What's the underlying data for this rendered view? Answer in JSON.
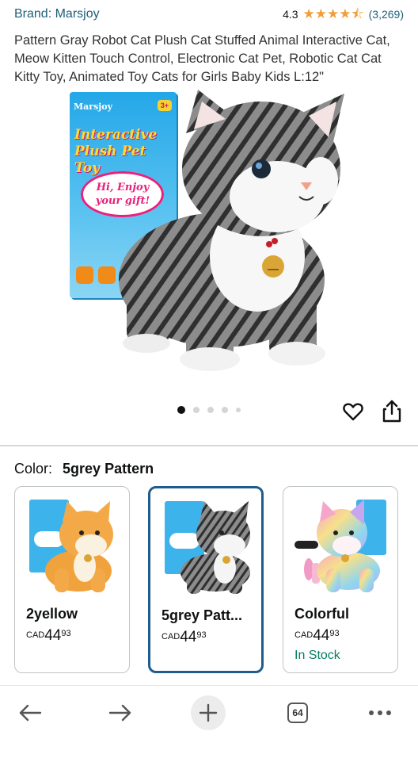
{
  "header": {
    "brand": "Brand: Marsjoy",
    "rating_value": "4.3",
    "rating_stars": 4.3,
    "rating_count": "(3,269)"
  },
  "product": {
    "title": "Pattern Gray Robot Cat Plush Cat Stuffed Animal Interactive Cat, Meow Kitten Touch Control, Electronic Cat Pet, Robotic Cat Cat Kitty Toy, Animated Toy Cats for Girls Baby Kids L:12\"",
    "box_logo": "Marsjoy",
    "box_age": "3+",
    "box_title": "Interactive Plush Pet Toy",
    "box_bubble": "Hi, Enjoy your gift!"
  },
  "gallery": {
    "image_count": 5,
    "current_index": 1
  },
  "color_section": {
    "label": "Color:",
    "selected": "5grey Pattern",
    "options": [
      {
        "name": "2yellow",
        "currency": "CAD",
        "amount": "44",
        "cents": "93",
        "stock": ""
      },
      {
        "name": "5grey Patt...",
        "currency": "CAD",
        "amount": "44",
        "cents": "93",
        "stock": ""
      },
      {
        "name": "Colorful",
        "currency": "CAD",
        "amount": "44",
        "cents": "93",
        "stock": "In Stock"
      }
    ]
  },
  "navbar": {
    "back_icon": "arrow-left-icon",
    "forward_icon": "arrow-right-icon",
    "new_tab_icon": "plus-icon",
    "tabs_count": "64",
    "menu_icon": "more-dots-icon"
  },
  "colors": {
    "link": "#1f5f7a",
    "star": "#f19e39",
    "selected_border": "#1f5c8e",
    "in_stock": "#067d62"
  }
}
